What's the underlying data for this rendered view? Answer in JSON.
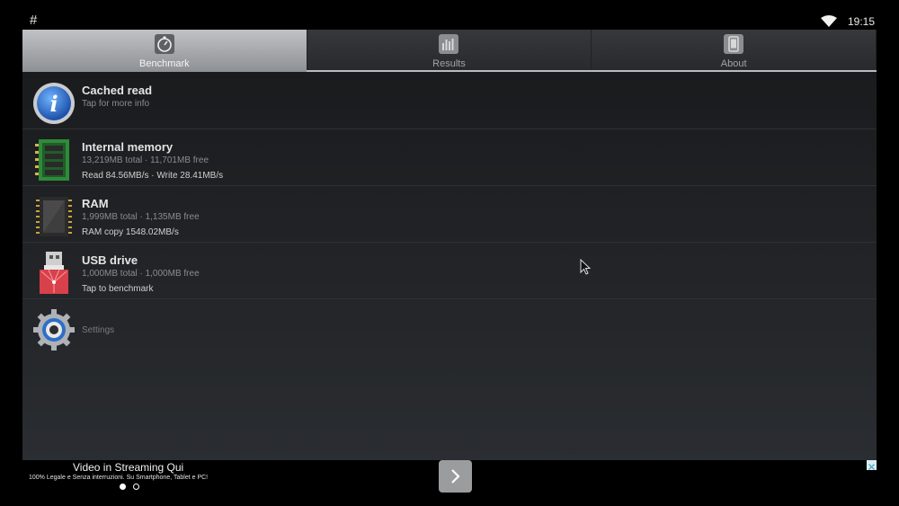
{
  "status_bar": {
    "hash": "#",
    "time": "19:15"
  },
  "tabs": [
    {
      "label": "Benchmark",
      "icon": "stopwatch-icon",
      "selected": true
    },
    {
      "label": "Results",
      "icon": "bar-chart-icon",
      "selected": false
    },
    {
      "label": "About",
      "icon": "phone-icon",
      "selected": false
    }
  ],
  "list": {
    "cached_read": {
      "title": "Cached read",
      "sub": "Tap for more info",
      "icon": "info-icon"
    },
    "internal_memory": {
      "title": "Internal memory",
      "sub": "13,219MB total · 11,701MB free",
      "detail": "Read 84.56MB/s · Write 28.41MB/s",
      "icon": "memory-card-icon"
    },
    "ram": {
      "title": "RAM",
      "sub": "1,999MB total · 1,135MB free",
      "detail": "RAM copy 1548.02MB/s",
      "icon": "chip-icon"
    },
    "usb_drive": {
      "title": "USB drive",
      "sub": "1,000MB total · 1,000MB free",
      "detail": "Tap to benchmark",
      "icon": "usb-drive-icon"
    },
    "settings": {
      "label": "Settings",
      "icon": "gear-icon"
    }
  },
  "ad": {
    "headline": "Video in Streaming Qui",
    "description": "100% Legale e Senza interruzioni. Su Smartphone, Tablet e PC!",
    "pager_active_index": 0
  },
  "colors": {
    "selected_tab": "#a6a8ab",
    "background": "#1f2124",
    "title_text": "#e4e4e4"
  }
}
